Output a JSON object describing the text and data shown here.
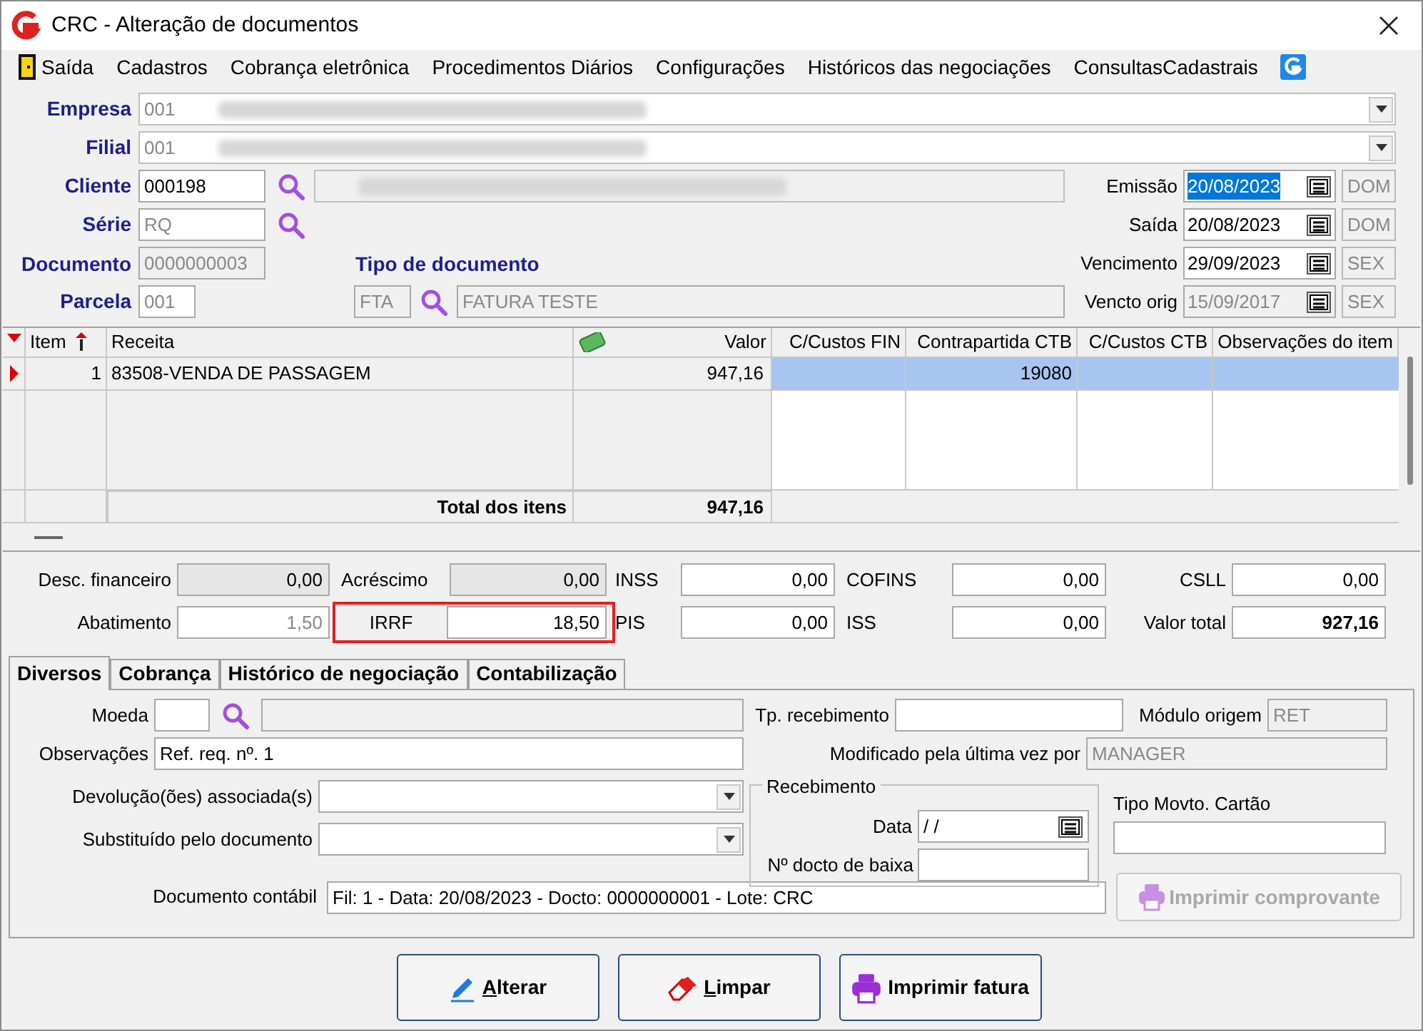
{
  "window": {
    "title": "CRC - Alteração de documentos"
  },
  "menu": [
    {
      "label": "Saída",
      "kind": "exit"
    },
    {
      "label": "Cadastros",
      "kind": "text"
    },
    {
      "label": "Cobrança eletrônica",
      "kind": "text"
    },
    {
      "label": "Procedimentos Diários",
      "kind": "text"
    },
    {
      "label": "Configurações",
      "kind": "text"
    },
    {
      "label": "Históricos das negociações",
      "kind": "text"
    },
    {
      "label": "ConsultasCadastrais",
      "kind": "text"
    },
    {
      "kind": "logo"
    }
  ],
  "header": {
    "empresa": {
      "label": "Empresa",
      "code": "001",
      "redacted": true
    },
    "filial": {
      "label": "Filial",
      "code": "001",
      "redacted": true
    },
    "cliente": {
      "label": "Cliente",
      "code": "000198",
      "redacted": true
    },
    "serie": {
      "label": "Série",
      "value": "RQ"
    },
    "documento": {
      "label": "Documento",
      "value": "0000000003"
    },
    "parcela": {
      "label": "Parcela",
      "value": "001"
    },
    "tipo_documento": {
      "label": "Tipo de documento",
      "code": "FTA",
      "name": "FATURA TESTE"
    },
    "dates": [
      {
        "label": "Emissão",
        "value": "20/08/2023",
        "day": "DOM",
        "selected": true,
        "disabled": false
      },
      {
        "label": "Saída",
        "value": "20/08/2023",
        "day": "DOM",
        "selected": false,
        "disabled": false
      },
      {
        "label": "Vencimento",
        "value": "29/09/2023",
        "day": "SEX",
        "selected": false,
        "disabled": false
      },
      {
        "label": "Vencto orig",
        "value": "15/09/2017",
        "day": "SEX",
        "selected": false,
        "disabled": true
      }
    ]
  },
  "grid": {
    "columns": [
      "Item",
      "Receita",
      "Valor",
      "C/Custos FIN",
      "Contrapartida CTB",
      "C/Custos CTB",
      "Observações do item"
    ],
    "rows": [
      {
        "item": "1",
        "receita": "83508-VENDA DE PASSAGEM",
        "valor": "947,16",
        "contrapartida_ctb": "19080",
        "selected": true
      }
    ],
    "total": {
      "label": "Total dos itens",
      "value": "947,16"
    }
  },
  "totals": [
    {
      "label": "Desc. financeiro",
      "value": "0,00",
      "disabled": true,
      "highlighted": false,
      "kind": "plain"
    },
    {
      "label": "Acréscimo",
      "value": "0,00",
      "disabled": true,
      "highlighted": false,
      "kind": "plain"
    },
    {
      "label": "INSS",
      "value": "0,00",
      "disabled": false,
      "highlighted": false,
      "kind": "plain"
    },
    {
      "label": "COFINS",
      "value": "0,00",
      "disabled": false,
      "highlighted": false,
      "kind": "plain"
    },
    {
      "label": "CSLL",
      "value": "0,00",
      "disabled": false,
      "highlighted": false,
      "kind": "plain"
    },
    {
      "label": "Abatimento",
      "value": "1,50",
      "disabled": false,
      "readonly": true,
      "highlighted": false,
      "kind": "plain"
    },
    {
      "label": "IRRF",
      "value": "18,50",
      "disabled": false,
      "highlighted": true,
      "kind": "plain"
    },
    {
      "label": "PIS",
      "value": "0,00",
      "disabled": false,
      "highlighted": false,
      "kind": "plain"
    },
    {
      "label": "ISS",
      "value": "0,00",
      "disabled": false,
      "highlighted": false,
      "kind": "plain"
    },
    {
      "label": "Valor total",
      "value": "927,16",
      "disabled": false,
      "highlighted": false,
      "kind": "total"
    }
  ],
  "tabs": [
    {
      "label": "Diversos",
      "selected": true
    },
    {
      "label": "Cobrança",
      "selected": false
    },
    {
      "label": "Histórico de negociação",
      "selected": false
    },
    {
      "label": "Contabilização",
      "selected": false
    }
  ],
  "diversos": {
    "moeda": {
      "label": "Moeda"
    },
    "observacoes": {
      "label": "Observações",
      "value": "Ref. req. nº. 1"
    },
    "devolucoes": {
      "label": "Devolução(ões) associada(s)"
    },
    "substituido": {
      "label": "Substituído pelo documento"
    },
    "tp_recebimento": {
      "label": "Tp. recebimento"
    },
    "modulo_origem": {
      "label": "Módulo origem",
      "value": "RET"
    },
    "modificado_por": {
      "label": "Modificado pela última vez por",
      "value": "MANAGER"
    },
    "recebimento": {
      "title": "Recebimento",
      "data_label": "Data",
      "data_value": "/ /",
      "docto_label": "Nº docto de baixa"
    },
    "tipo_movto_cartao": {
      "label": "Tipo Movto. Cartão"
    },
    "documento_contabil": {
      "label": "Documento contábil",
      "value": "Fil: 1 - Data: 20/08/2023 - Docto: 0000000001 - Lote: CRC"
    },
    "imprimir_comprovante": {
      "label": "Imprimir comprovante",
      "disabled": true
    }
  },
  "buttons": [
    {
      "label": "Alterar",
      "kind": "edit",
      "underline_first": true
    },
    {
      "label": "Limpar",
      "kind": "clear",
      "underline_first": true
    },
    {
      "label": "Imprimir fatura",
      "kind": "print",
      "underline_first": false
    }
  ]
}
